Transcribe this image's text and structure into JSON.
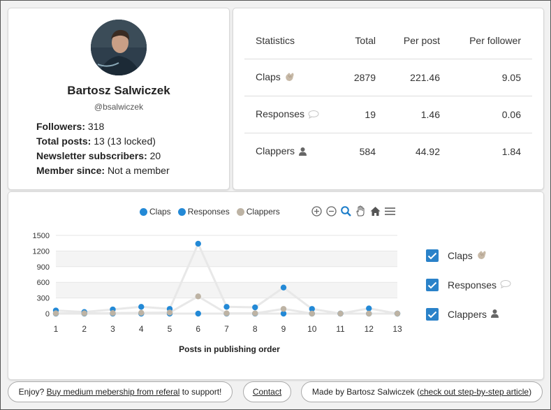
{
  "profile": {
    "name": "Bartosz Salwiczek",
    "handle": "@bsalwiczek",
    "followers_label": "Followers:",
    "followers_value": "318",
    "posts_label": "Total posts:",
    "posts_value": "13 (13 locked)",
    "newsletter_label": "Newsletter subscribers:",
    "newsletter_value": "20",
    "member_label": "Member since:",
    "member_value": "Not a member"
  },
  "stats": {
    "headers": [
      "Statistics",
      "Total",
      "Per post",
      "Per follower"
    ],
    "rows": [
      {
        "label": "Claps",
        "icon": "clap-icon",
        "total": "2879",
        "per_post": "221.46",
        "per_follower": "9.05"
      },
      {
        "label": "Responses",
        "icon": "speech-bubble-icon",
        "total": "19",
        "per_post": "1.46",
        "per_follower": "0.06"
      },
      {
        "label": "Clappers",
        "icon": "person-icon",
        "total": "584",
        "per_post": "44.92",
        "per_follower": "1.84"
      }
    ]
  },
  "chart_data": {
    "type": "line",
    "title": "",
    "xlabel": "Posts in publishing order",
    "ylabel": "",
    "x": [
      1,
      2,
      3,
      4,
      5,
      6,
      7,
      8,
      9,
      10,
      11,
      12,
      13
    ],
    "yticks": [
      "0",
      "300",
      "600",
      "900",
      "1200",
      "1500"
    ],
    "ylim": [
      0,
      1500
    ],
    "legend_position": "top-center",
    "grid": true,
    "series": [
      {
        "name": "Claps",
        "color": "#2389d6",
        "values": [
          60,
          30,
          80,
          130,
          90,
          1340,
          130,
          120,
          500,
          90,
          0,
          100,
          0
        ]
      },
      {
        "name": "Responses",
        "color": "#2389d6",
        "values": [
          0,
          0,
          0,
          0,
          0,
          0,
          0,
          0,
          0,
          0,
          0,
          0,
          0
        ]
      },
      {
        "name": "Clappers",
        "color": "#bdb3a4",
        "values": [
          5,
          5,
          10,
          15,
          20,
          330,
          5,
          5,
          90,
          0,
          0,
          0,
          0
        ]
      }
    ]
  },
  "toggles": [
    {
      "label": "Claps",
      "checked": true,
      "icon": "clap-icon"
    },
    {
      "label": "Responses",
      "checked": true,
      "icon": "speech-bubble-icon"
    },
    {
      "label": "Clappers",
      "checked": true,
      "icon": "person-icon"
    }
  ],
  "footer": {
    "enjoy_prefix": "Enjoy? ",
    "enjoy_link": "Buy medium mebership from referal",
    "enjoy_suffix": " to support!",
    "contact": "Contact",
    "made_prefix": "Made by Bartosz Salwiczek (",
    "made_link": "check out step-by-step article",
    "made_suffix": ")"
  },
  "colors": {
    "accent": "#2a82c9",
    "claps": "#2389d6",
    "clappers": "#bdb3a4"
  }
}
